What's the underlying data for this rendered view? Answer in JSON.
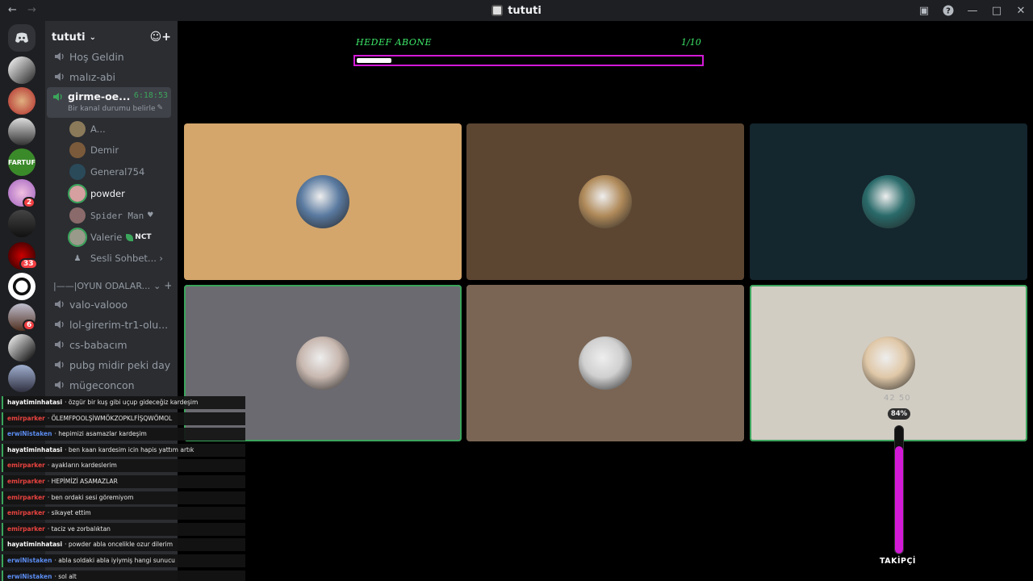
{
  "window": {
    "title": "tututi"
  },
  "guild": {
    "name": "tututi"
  },
  "servers": [
    {
      "badge": ""
    },
    {
      "badge": ""
    },
    {
      "badge": ""
    },
    {
      "badge": "",
      "label": "FARTUF"
    },
    {
      "badge": "2"
    },
    {
      "badge": ""
    },
    {
      "badge": "33"
    },
    {
      "badge": ""
    },
    {
      "badge": "6"
    },
    {
      "badge": ""
    },
    {
      "badge": ""
    }
  ],
  "channels": {
    "top": [
      "Hoş Geldin",
      "malız-abi"
    ],
    "active": {
      "name": "girme-oe...",
      "timer": "6:18:53",
      "status": "Bir kanal durumu belirle"
    },
    "members": [
      {
        "name": "A...",
        "color": "#8a7a5a"
      },
      {
        "name": "Demir",
        "color": "#7a5a3a"
      },
      {
        "name": "General754",
        "color": "#2a4a5a"
      },
      {
        "name": "powder",
        "color": "#d6a0a0"
      },
      {
        "name": "Spider Man",
        "color": "#8a6a6a"
      },
      {
        "name": "Valerie",
        "color": "#9a9a8a",
        "tag": "NCT"
      }
    ],
    "more": "Sesli Sohbet...",
    "category": "|——|OYUN ODALAR...",
    "game": [
      "valo-valooo",
      "lol-girerim-tr1-olu...",
      "cs-babacım",
      "pubg midir peki dayı",
      "mügeconcon"
    ]
  },
  "goal": {
    "label": "HEDEF ABONE",
    "count": "1/10",
    "progress": 0.1
  },
  "tiles": [
    {
      "bg": "#d4a66b",
      "pic": "#5a7aa0",
      "speaking": false
    },
    {
      "bg": "#5c4632",
      "pic": "#b08a5a",
      "speaking": false
    },
    {
      "bg": "#14262e",
      "pic": "#2a6a6a",
      "speaking": false
    },
    {
      "bg": "#6b6a70",
      "pic": "#c8b8b0",
      "speaking": true
    },
    {
      "bg": "#7a6554",
      "pic": "#d0d0d0",
      "speaking": false
    },
    {
      "bg": "#d2cdc3",
      "pic": "#e0c8a8",
      "speaking": true
    }
  ],
  "chat": [
    {
      "user": "hayatiminhatasi",
      "ucolor": "#ffffff",
      "text": "özgür bir kuş gibi uçup gideceğiz kardeşim"
    },
    {
      "user": "emirparker",
      "ucolor": "#e8433f",
      "text": "ÖLEMFPOOLŞİWMÖKZOPKLFİŞQWÖMOL"
    },
    {
      "user": "erwiNistaken",
      "ucolor": "#5b8cf0",
      "text": "hepimizi asamazlar kardeşim"
    },
    {
      "user": "hayatiminhatasi",
      "ucolor": "#ffffff",
      "text": "ben kaan kardesim icin hapis yattım artık"
    },
    {
      "user": "emirparker",
      "ucolor": "#e8433f",
      "text": "ayakların kardeslerim"
    },
    {
      "user": "emirparker",
      "ucolor": "#e8433f",
      "text": "HEPİMİZİ ASAMAZLAR"
    },
    {
      "user": "emirparker",
      "ucolor": "#e8433f",
      "text": "ben ordaki sesi göremiyom"
    },
    {
      "user": "emirparker",
      "ucolor": "#e8433f",
      "text": "sikayet ettim"
    },
    {
      "user": "emirparker",
      "ucolor": "#e8433f",
      "text": "taciz ve zorbalıktan"
    },
    {
      "user": "hayatiminhatasi",
      "ucolor": "#ffffff",
      "text": "powder abla oncelikle ozur dilerim"
    },
    {
      "user": "erwiNistaken",
      "ucolor": "#5b8cf0",
      "text": "abla soldaki abla iyiymiş hangi sunucu"
    },
    {
      "user": "erwiNistaken",
      "ucolor": "#5b8cf0",
      "text": "sol alt"
    }
  ],
  "follower_bar": {
    "label": "TAKİPÇİ",
    "percent_text": "84%",
    "numbers": "42  50",
    "level": 0.84
  },
  "colors": {
    "accent": "#d21ad6",
    "goal_text": "#3ee86a",
    "speaking": "#3ba55c"
  }
}
